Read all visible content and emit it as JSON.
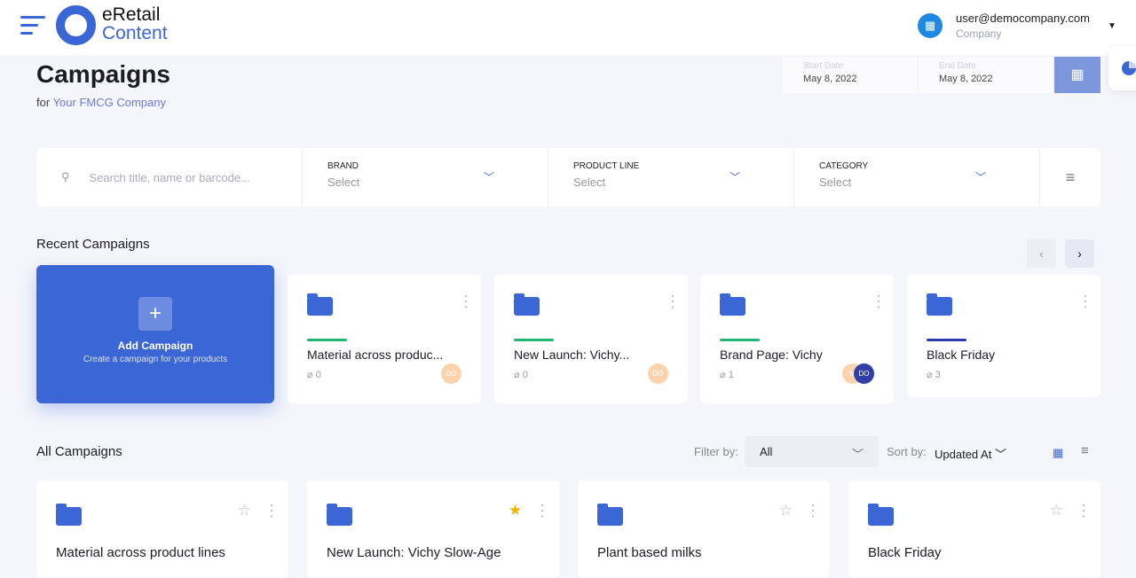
{
  "header": {
    "logo_line1": "eRetail",
    "logo_line2": "Content",
    "user_email": "user@democompany.com",
    "user_role": "Company"
  },
  "page": {
    "title": "Campaigns",
    "subtitle_prefix": "for",
    "company": "Your FMCG Company"
  },
  "dates": {
    "start_label": "Start Date",
    "start_value": "May 8, 2022",
    "end_label": "End Date",
    "end_value": "May 8, 2022"
  },
  "filters": {
    "search_placeholder": "Search title, name or barcode...",
    "brand_label": "BRAND",
    "brand_value": "Select",
    "product_line_label": "PRODUCT LINE",
    "product_line_value": "Select",
    "category_label": "CATEGORY",
    "category_value": "Select"
  },
  "recent": {
    "title": "Recent Campaigns",
    "add_title": "Add Campaign",
    "add_subtitle": "Create a campaign for your products",
    "cards": [
      {
        "title": "Material across produc...",
        "count": "0",
        "bar_color": "#22b573",
        "avatars": [
          "DO"
        ]
      },
      {
        "title": "New Launch: Vichy...",
        "count": "0",
        "bar_color": "#22b573",
        "avatars": [
          "DO"
        ]
      },
      {
        "title": "Brand Page: Vichy",
        "count": "1",
        "bar_color": "#22b573",
        "avatars": [
          "M",
          "DO"
        ]
      },
      {
        "title": "Black Friday",
        "count": "3",
        "bar_color": "#2a3aa8",
        "avatars": []
      }
    ]
  },
  "all": {
    "title": "All Campaigns",
    "filter_label": "Filter by:",
    "filter_value": "All",
    "sort_label": "Sort by:",
    "sort_value": "Updated At",
    "cards": [
      {
        "title": "Material across product lines",
        "starred": false
      },
      {
        "title": "New Launch: Vichy Slow-Age",
        "starred": true
      },
      {
        "title": "Plant based milks",
        "starred": false
      },
      {
        "title": "Black Friday",
        "starred": false
      }
    ]
  }
}
